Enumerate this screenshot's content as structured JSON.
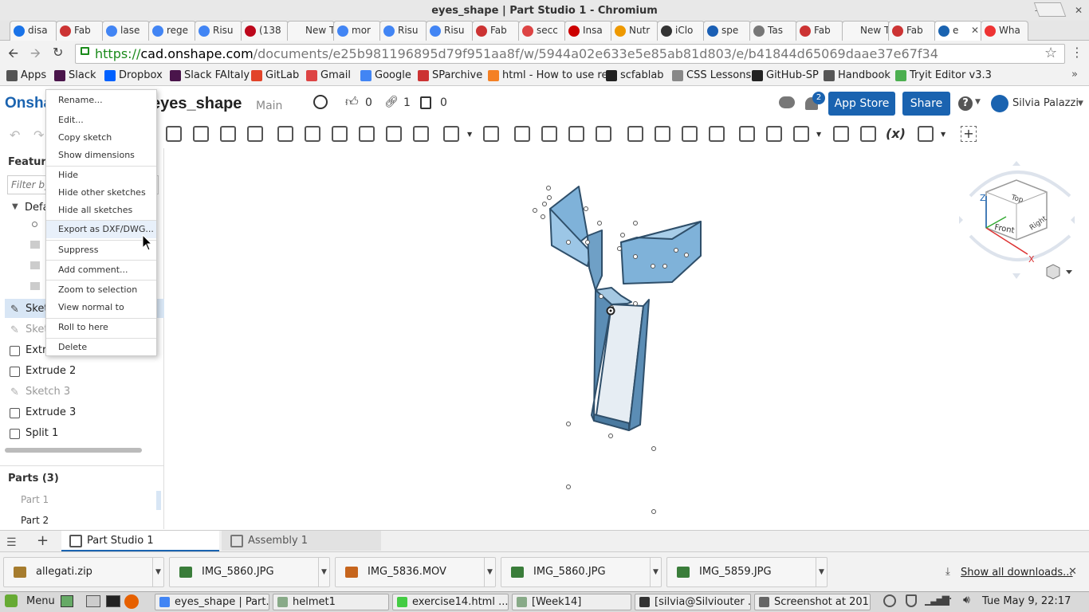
{
  "window": {
    "title": "eyes_shape | Part Studio 1 - Chromium"
  },
  "tabs": [
    {
      "label": "disa",
      "color": "#1a73e8"
    },
    {
      "label": "Fab",
      "color": "#c33"
    },
    {
      "label": "lase",
      "color": "#4285f4"
    },
    {
      "label": "rege",
      "color": "#4285f4"
    },
    {
      "label": "Risu",
      "color": "#4285f4"
    },
    {
      "label": "(138",
      "color": "#bd081c"
    },
    {
      "label": "New Ta",
      "color": ""
    },
    {
      "label": "mor",
      "color": "#4285f4"
    },
    {
      "label": "Risu",
      "color": "#4285f4"
    },
    {
      "label": "Risu",
      "color": "#4285f4"
    },
    {
      "label": "Fab",
      "color": "#c33"
    },
    {
      "label": "secc",
      "color": "#d44"
    },
    {
      "label": "Insa",
      "color": "#c00"
    },
    {
      "label": "Nutr",
      "color": "#e90"
    },
    {
      "label": "iClo",
      "color": "#333"
    },
    {
      "label": "spe",
      "color": "#1a5fb4"
    },
    {
      "label": "Tas",
      "color": "#777"
    },
    {
      "label": "Fab",
      "color": "#c33"
    },
    {
      "label": "New Ta",
      "color": ""
    },
    {
      "label": "Fab",
      "color": "#c33"
    },
    {
      "label": "e",
      "color": "#1a63b0"
    },
    {
      "label": "Wha",
      "color": "#e33"
    }
  ],
  "address": {
    "scheme": "https://",
    "host": "cad.onshape.com",
    "path": "/documents/e25b981196895d79f951aa8f/w/5944a02e633e5e85ab81d803/e/b41844d65069daae37e67f34"
  },
  "bookmarks": [
    {
      "label": "Apps",
      "color": "#555"
    },
    {
      "label": "Slack",
      "color": "#4a154b"
    },
    {
      "label": "Dropbox",
      "color": "#0061ff"
    },
    {
      "label": "Slack FAItaly",
      "color": "#4a154b"
    },
    {
      "label": "GitLab",
      "color": "#e24329"
    },
    {
      "label": "Gmail",
      "color": "#d44"
    },
    {
      "label": "Google",
      "color": "#4285f4"
    },
    {
      "label": "SParchive",
      "color": "#c33"
    },
    {
      "label": "html - How to use re",
      "color": "#f48024"
    },
    {
      "label": "scfablab",
      "color": "#222"
    },
    {
      "label": "CSS Lessons",
      "color": "#888"
    },
    {
      "label": "GitHub-SP",
      "color": "#222"
    },
    {
      "label": "Handbook",
      "color": "#555"
    },
    {
      "label": "Tryit Editor v3.3",
      "color": "#4caf50"
    }
  ],
  "onshape": {
    "logo": "Onsha",
    "doc_name": "eyes_shape",
    "branch": "Main",
    "likes": "0",
    "links": "1",
    "copies": "0",
    "notifications": "2",
    "app_store": "App Store",
    "share": "Share",
    "help": "?",
    "user": "Silvia Palazzi"
  },
  "features": {
    "title": "Feature",
    "filter_placeholder": "Filter by",
    "default_group": "Defa",
    "items": [
      {
        "label": "Sketc",
        "dim": false
      },
      {
        "label": "Sketc",
        "dim": true
      },
      {
        "label": "Extru",
        "dim": false
      },
      {
        "label": "Extrude 2",
        "dim": false
      },
      {
        "label": "Sketch 3",
        "dim": true
      },
      {
        "label": "Extrude 3",
        "dim": false
      },
      {
        "label": "Split 1",
        "dim": false
      }
    ],
    "parts_title": "Parts (3)",
    "parts": [
      {
        "label": "Part 1",
        "dim": true
      },
      {
        "label": "Part 2",
        "dim": false
      }
    ]
  },
  "context_menu": {
    "items": [
      "Rename...",
      "Edit...",
      "Copy sketch",
      "Show dimensions",
      "Hide",
      "Hide other sketches",
      "Hide all sketches",
      "Export as DXF/DWG...",
      "Suppress",
      "Add comment...",
      "Zoom to selection",
      "View normal to",
      "Roll to here",
      "Delete"
    ]
  },
  "viewcube": {
    "top": "Top",
    "front": "Front",
    "right": "Right",
    "x": "X",
    "z": "Z"
  },
  "bottom_tabs": [
    {
      "label": "Part Studio 1"
    },
    {
      "label": "Assembly 1"
    }
  ],
  "downloads": {
    "items": [
      {
        "label": "allegati.zip",
        "color": "#a67c2e"
      },
      {
        "label": "IMG_5860.JPG",
        "color": "#3a7d3a"
      },
      {
        "label": "IMG_5836.MOV",
        "color": "#c6651d"
      },
      {
        "label": "IMG_5860.JPG",
        "color": "#3a7d3a"
      },
      {
        "label": "IMG_5859.JPG",
        "color": "#3a7d3a"
      }
    ],
    "show_all": "Show all downloads..."
  },
  "taskbar": {
    "menu": "Menu",
    "items": [
      {
        "label": "eyes_shape | Part...",
        "color": "#4285f4"
      },
      {
        "label": "helmet1",
        "color": "#8a8"
      },
      {
        "label": "exercise14.html ...",
        "color": "#4c4"
      },
      {
        "label": "[Week14]",
        "color": "#8a8"
      },
      {
        "label": "[silvia@Silviouter ...",
        "color": "#333"
      },
      {
        "label": "Screenshot at 201...",
        "color": "#666"
      }
    ],
    "clock": "Tue May  9, 22:17"
  }
}
